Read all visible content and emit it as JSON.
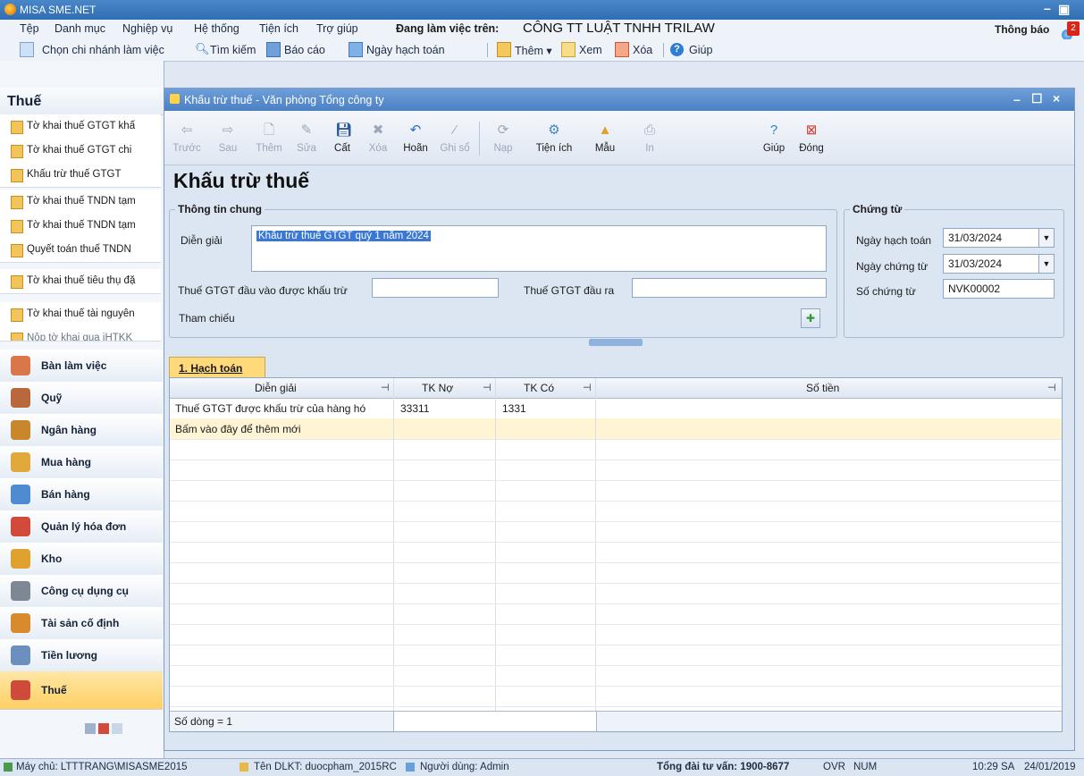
{
  "app": {
    "title": "MISA SME.NET",
    "working_label": "Đang làm việc trên:",
    "company": "CÔNG TT LUẬT TNHH TRILAW",
    "notification_label": "Thông báo",
    "notification_count": "2"
  },
  "menu": [
    "Tệp",
    "Danh mục",
    "Nghiệp vụ",
    "Hệ thống",
    "Tiện ích",
    "Trợ giúp"
  ],
  "app_toolbar": {
    "branch": "Chọn chi nhánh làm việc",
    "search": "Tìm kiếm",
    "report": "Báo cáo",
    "posting_date": "Ngày hạch toán",
    "add": "Thêm",
    "view": "Xem",
    "delete": "Xóa",
    "help": "Giúp"
  },
  "sidebar": {
    "title": "Thuế",
    "items": [
      "Tờ khai thuế GTGT khấ",
      "Tờ khai thuế GTGT chi",
      "Khấu trừ thuế GTGT",
      "Tờ khai thuế TNDN tạm",
      "Tờ khai thuế TNDN tạm",
      "Quyết toán thuế TNDN",
      "Tờ khai thuế tiêu thụ đặ",
      "Tờ khai thuế tài nguyên",
      "Nộp tờ khai qua iHTKK"
    ],
    "modules": [
      {
        "label": "Bàn làm việc",
        "color": "#d9774a"
      },
      {
        "label": "Quỹ",
        "color": "#b8683c"
      },
      {
        "label": "Ngân hàng",
        "color": "#c7872a"
      },
      {
        "label": "Mua hàng",
        "color": "#e1a93b"
      },
      {
        "label": "Bán hàng",
        "color": "#4e8bd1"
      },
      {
        "label": "Quản lý hóa đơn",
        "color": "#d44a3a"
      },
      {
        "label": "Kho",
        "color": "#e0a22e"
      },
      {
        "label": "Công cụ dụng cụ",
        "color": "#7d8894"
      },
      {
        "label": "Tài sản cố định",
        "color": "#d88a2d"
      },
      {
        "label": "Tiền lương",
        "color": "#6b8fbf"
      },
      {
        "label": "Thuế",
        "color": "#cf4a3b"
      }
    ]
  },
  "child_window": {
    "title": "Khấu trừ thuế - Văn phòng Tổng công ty",
    "toolbar": [
      {
        "label": "Trước",
        "icon": "arrow-left",
        "enabled": false
      },
      {
        "label": "Sau",
        "icon": "arrow-right",
        "enabled": false
      },
      {
        "label": "Thêm",
        "icon": "add-doc",
        "enabled": false
      },
      {
        "label": "Sửa",
        "icon": "edit-doc",
        "enabled": false
      },
      {
        "label": "Cất",
        "icon": "save",
        "enabled": true
      },
      {
        "label": "Xóa",
        "icon": "delete",
        "enabled": false
      },
      {
        "label": "Hoãn",
        "icon": "undo",
        "enabled": true
      },
      {
        "label": "Ghi sổ",
        "icon": "post",
        "enabled": false
      },
      {
        "label": "Nạp",
        "icon": "reload",
        "enabled": false
      },
      {
        "label": "Tiện ích",
        "icon": "utilities",
        "enabled": true
      },
      {
        "label": "Mẫu",
        "icon": "template",
        "enabled": true
      },
      {
        "label": "In",
        "icon": "print",
        "enabled": false
      },
      {
        "label": "Giúp",
        "icon": "help",
        "enabled": true
      },
      {
        "label": "Đóng",
        "icon": "close",
        "enabled": true
      }
    ],
    "form_title": "Khấu trừ thuế",
    "general": {
      "group_title": "Thông tin chung",
      "desc_label": "Diễn giải",
      "desc_value": "Khấu trừ thuế GTGT quý 1 năm 2024",
      "vat_in_label": "Thuế GTGT đầu vào được khấu trừ",
      "vat_out_label": "Thuế GTGT đầu ra",
      "reference_label": "Tham chiếu"
    },
    "voucher": {
      "group_title": "Chứng từ",
      "posting_date_label": "Ngày hạch toán",
      "posting_date": "31/03/2024",
      "voucher_date_label": "Ngày chứng từ",
      "voucher_date": "31/03/2024",
      "voucher_no_label": "Số chứng từ",
      "voucher_no": "NVK00002"
    },
    "tab_label": "1. Hạch toán",
    "grid": {
      "columns": [
        "Diễn giải",
        "TK Nợ",
        "TK Có",
        "Số tiền"
      ],
      "rows": [
        [
          "Thuế GTGT được khấu trừ của hàng hó",
          "33311",
          "1331",
          ""
        ]
      ],
      "new_row_hint": "Bấm vào đây để thêm mới",
      "row_count": "Số dòng = 1"
    }
  },
  "statusbar": {
    "server": "Máy chủ: LTTTRANG\\MISASME2015",
    "db": "Tên DLKT: duocpham_2015RC",
    "user": "Người dùng: Admin",
    "hotline": "Tổng đài tư vấn: 1900-8677",
    "ovr": "OVR",
    "num": "NUM",
    "time": "10:29 SA",
    "date": "24/01/2019"
  }
}
